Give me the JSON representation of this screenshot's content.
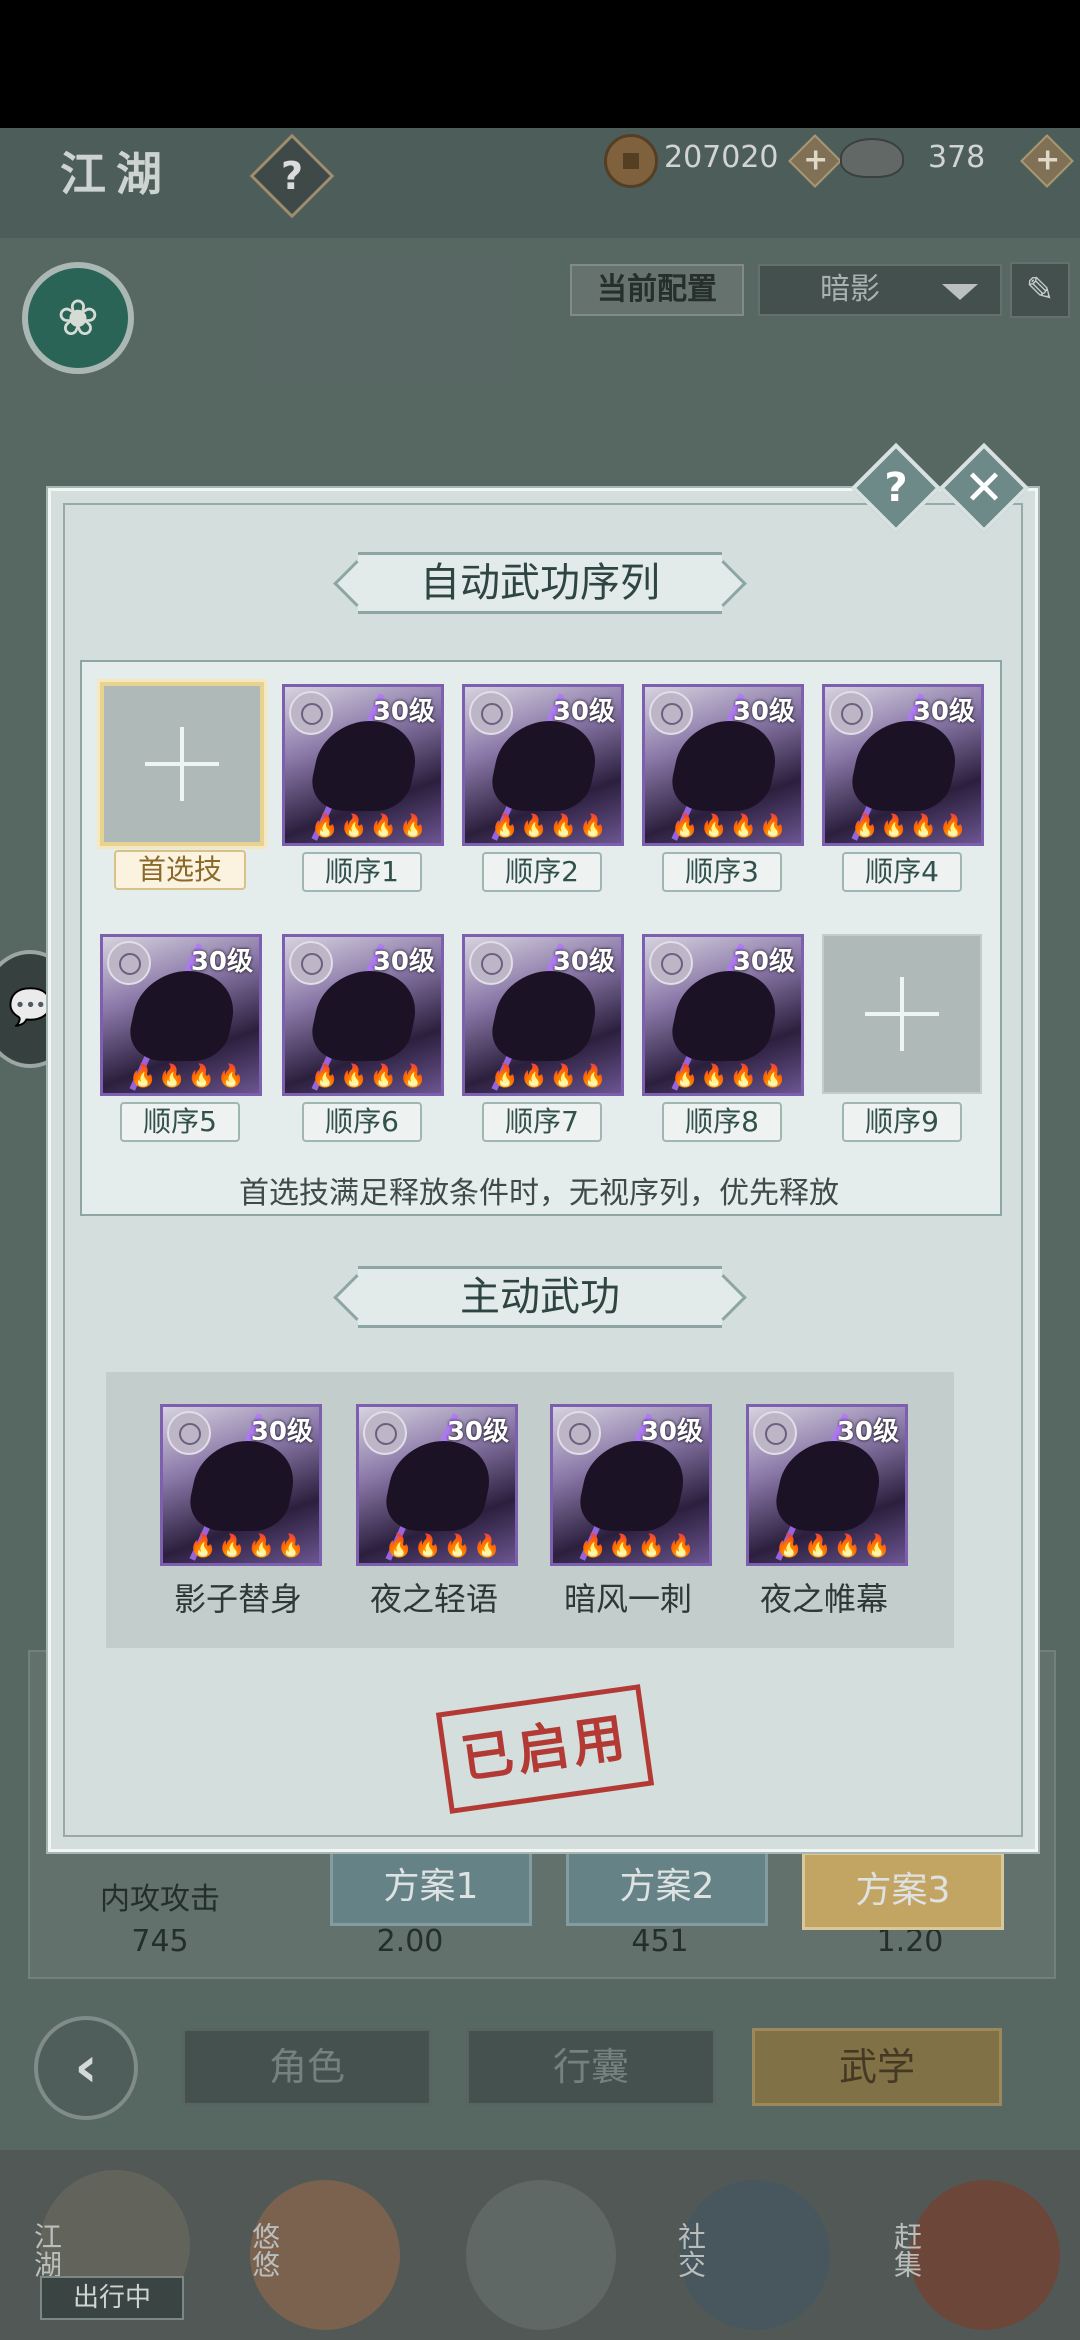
{
  "header": {
    "title": "江湖",
    "help_icon": "?"
  },
  "currency": {
    "coins": "207020",
    "ingots": "378"
  },
  "config": {
    "label": "当前配置",
    "selected": "暗影"
  },
  "stats": [
    {
      "label": "内攻攻击",
      "value": "745"
    },
    {
      "label": "",
      "value": "2.00"
    },
    {
      "label": "",
      "value": "451"
    },
    {
      "label": "",
      "value": "1.20"
    }
  ],
  "plans": [
    {
      "label": "方案1",
      "active": false
    },
    {
      "label": "方案2",
      "active": false
    },
    {
      "label": "方案3",
      "active": true
    }
  ],
  "nav_tabs": [
    {
      "label": "角色",
      "active": false
    },
    {
      "label": "行囊",
      "active": false
    },
    {
      "label": "武学",
      "active": true
    }
  ],
  "bottom_bar": {
    "items": [
      "江湖",
      "悠悠",
      "",
      "社交",
      "赶集"
    ],
    "chuxing": "出行中"
  },
  "modal": {
    "help_icon": "?",
    "close_icon": "✕",
    "seq_title": "自动武功序列",
    "slots": [
      {
        "tag": "首选技",
        "empty": true,
        "level": ""
      },
      {
        "tag": "顺序1",
        "empty": false,
        "level": "30级"
      },
      {
        "tag": "顺序2",
        "empty": false,
        "level": "30级"
      },
      {
        "tag": "顺序3",
        "empty": false,
        "level": "30级"
      },
      {
        "tag": "顺序4",
        "empty": false,
        "level": "30级"
      },
      {
        "tag": "顺序5",
        "empty": false,
        "level": "30级"
      },
      {
        "tag": "顺序6",
        "empty": false,
        "level": "30级"
      },
      {
        "tag": "顺序7",
        "empty": false,
        "level": "30级"
      },
      {
        "tag": "顺序8",
        "empty": false,
        "level": "30级"
      },
      {
        "tag": "顺序9",
        "empty": true,
        "level": ""
      }
    ],
    "note": "首选技满足释放条件时，无视序列，优先释放",
    "active_title": "主动武功",
    "active_skills": [
      {
        "name": "影子替身",
        "level": "30级"
      },
      {
        "name": "夜之轻语",
        "level": "30级"
      },
      {
        "name": "暗风一刺",
        "level": "30级"
      },
      {
        "name": "夜之帷幕",
        "level": "30级"
      }
    ],
    "stamp": "已启用"
  },
  "stars": "🔥🔥🔥🔥"
}
